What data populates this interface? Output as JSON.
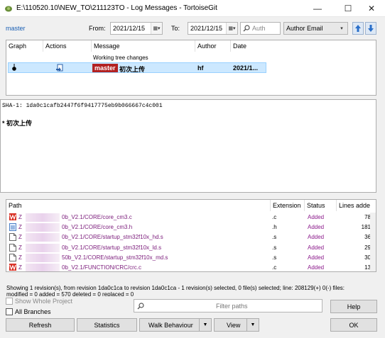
{
  "window": {
    "title": "E:\\110520.10\\NEW_TO\\211123TO - Log Messages - TortoiseGit",
    "minimize": "—",
    "maximize": "☐",
    "close": "✕"
  },
  "filter": {
    "branch": "master",
    "from_label": "From:",
    "from_date": "2021/12/15",
    "to_label": "To:",
    "to_date": "2021/12/15",
    "search_placeholder": "Auth",
    "field_select": "Author Email"
  },
  "log": {
    "columns": [
      "Graph",
      "Actions",
      "Message",
      "Author",
      "Date"
    ],
    "working_tree": "Working tree changes",
    "commit": {
      "branch_badge": "master",
      "message": "初次上传",
      "author": "hf",
      "date": "2021/1..."
    }
  },
  "details": {
    "sha": "SHA-1: 1da0c1cafb2447f6f9417775eb9b066667c4c001",
    "message": "* 初次上传"
  },
  "files": {
    "columns": [
      "Path",
      "Extension",
      "Status",
      "Lines adde"
    ],
    "rows": [
      {
        "icon": "source-file-icon",
        "path": "0b_V2.1/CORE/core_cm3.c",
        "ext": ".c",
        "status": "Added",
        "lines": "78"
      },
      {
        "icon": "header-file-icon",
        "path": "0b_V2.1/CORE/core_cm3.h",
        "ext": ".h",
        "status": "Added",
        "lines": "181"
      },
      {
        "icon": "file-icon",
        "path": "0b_V2.1/CORE/startup_stm32f10x_hd.s",
        "ext": ".s",
        "status": "Added",
        "lines": "36"
      },
      {
        "icon": "file-icon",
        "path": "0b_V2.1/CORE/startup_stm32f10x_ld.s",
        "ext": ".s",
        "status": "Added",
        "lines": "29"
      },
      {
        "icon": "file-icon",
        "path": "50b_V2.1/CORE/startup_stm32f10x_md.s",
        "ext": ".s",
        "status": "Added",
        "lines": "30"
      },
      {
        "icon": "source-file-icon",
        "path": "0b_V2.1/FUNCTION/CRC/crc.c",
        "ext": ".c",
        "status": "Added",
        "lines": "13"
      }
    ],
    "row_prefix": "Z"
  },
  "status": {
    "line1": "Showing 1 revision(s), from revision 1da0c1ca to revision 1da0c1ca - 1 revision(s) selected, 0 file(s) selected; line: 208129(+) 0(-) files:",
    "line2": "modified = 0 added = 570 deleted = 0 replaced = 0"
  },
  "options": {
    "show_whole_project": "Show Whole Project",
    "all_branches": "All Branches",
    "filter_paths_placeholder": "Filter paths"
  },
  "buttons": {
    "help": "Help",
    "refresh": "Refresh",
    "statistics": "Statistics",
    "walk_behaviour": "Walk Behaviour",
    "view": "View",
    "ok": "OK"
  },
  "colors": {
    "branch_badge_bg": "#b22222",
    "selection_bg": "#cce8ff",
    "added_status": "#8b1a8b"
  }
}
